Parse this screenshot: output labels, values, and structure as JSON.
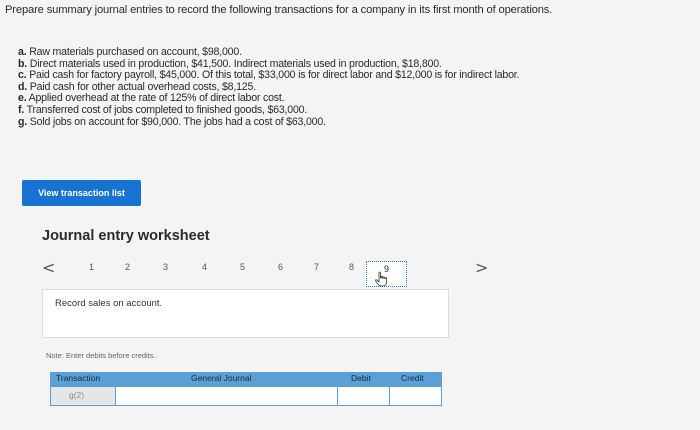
{
  "instructions": "Prepare summary journal entries to record the following transactions for a company in its first month of operations.",
  "transactions": [
    {
      "letter": "a.",
      "text": "Raw materials purchased on account, $98,000."
    },
    {
      "letter": "b.",
      "text": "Direct materials used in production, $41,500. Indirect materials used in production, $18,800."
    },
    {
      "letter": "c.",
      "text": "Paid cash for factory payroll, $45,000. Of this total, $33,000 is for direct labor and $12,000 is for indirect labor."
    },
    {
      "letter": "d.",
      "text": "Paid cash for other actual overhead costs, $8,125."
    },
    {
      "letter": "e.",
      "text": "Applied overhead at the rate of 125% of direct labor cost."
    },
    {
      "letter": "f.",
      "text": "Transferred cost of jobs completed to finished goods, $63,000."
    },
    {
      "letter": "g.",
      "text": "Sold jobs on account for $90,000. The jobs had a cost of $63,000."
    }
  ],
  "view_button_label": "View transaction list",
  "worksheet": {
    "title": "Journal entry worksheet",
    "prev_arrow": "<",
    "next_arrow": ">",
    "pages": [
      "1",
      "2",
      "3",
      "4",
      "5",
      "6",
      "7",
      "8",
      "9"
    ],
    "active_page": "9",
    "description": "Record sales on account.",
    "note": "Note: Enter debits before credits.",
    "table": {
      "headers": {
        "transaction": "Transaction",
        "account": "General Journal",
        "debit": "Debit",
        "credit": "Credit"
      },
      "row_transaction": "g(2)"
    }
  },
  "colors": {
    "accent": "#1673d2",
    "table_header": "#5a9fd6"
  },
  "icons": {
    "cursor": "hand-pointer-icon"
  }
}
